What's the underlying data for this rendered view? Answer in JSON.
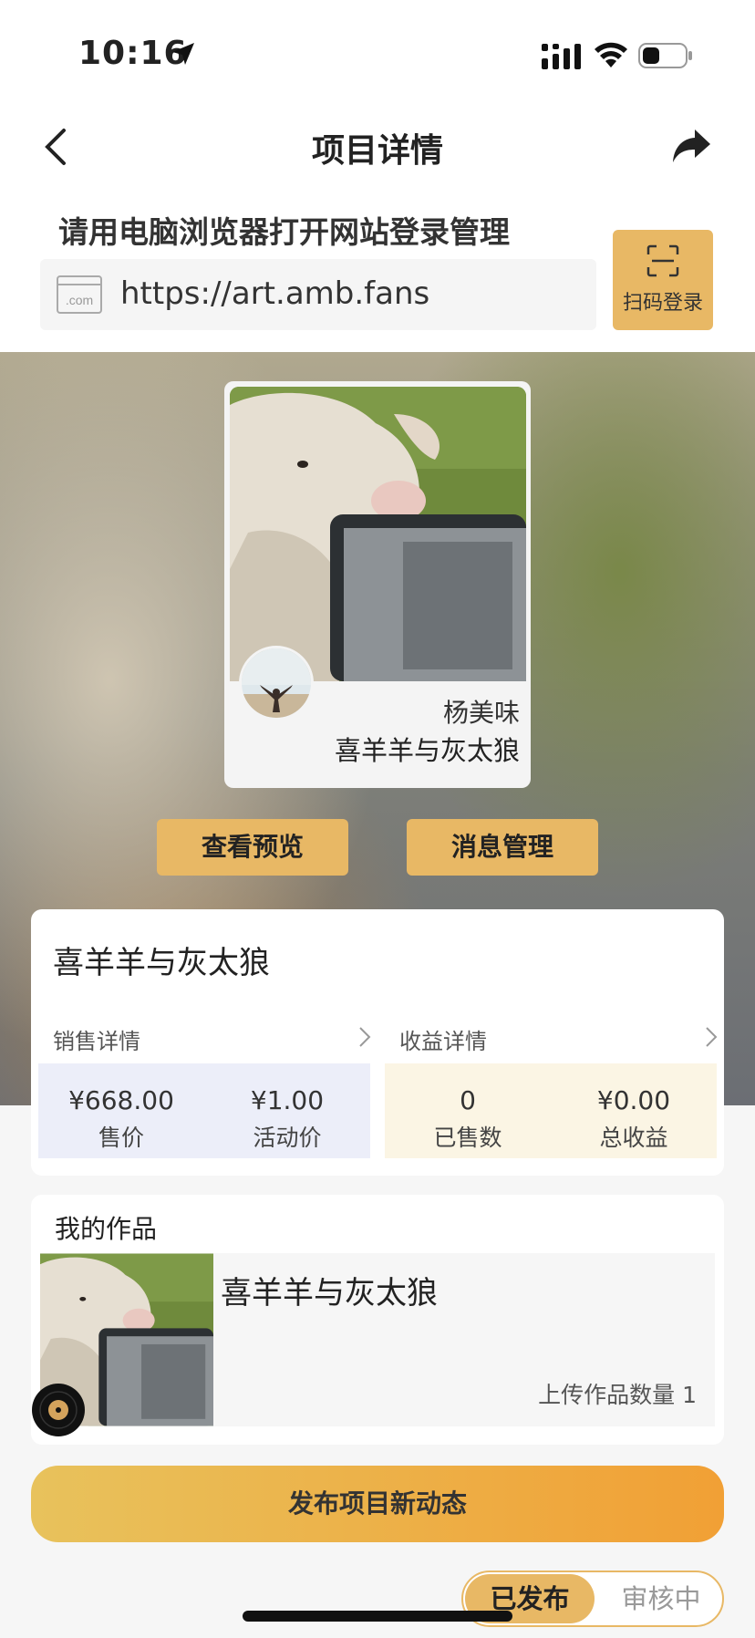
{
  "status_bar": {
    "time": "10:16"
  },
  "nav": {
    "title": "项目详情"
  },
  "login": {
    "hint": "请用电脑浏览器打开网站登录管理",
    "url": "https://art.amb.fans",
    "scan_label": "扫码登录",
    "com_icon_text": ".com"
  },
  "hero": {
    "author": "杨美味",
    "title": "喜羊羊与灰太狼",
    "preview_button": "查看预览",
    "message_button": "消息管理"
  },
  "info": {
    "title": "喜羊羊与灰太狼",
    "sales": {
      "label": "销售详情",
      "items": [
        {
          "value": "¥668.00",
          "caption": "售价"
        },
        {
          "value": "¥1.00",
          "caption": "活动价"
        }
      ]
    },
    "income": {
      "label": "收益详情",
      "items": [
        {
          "value": "0",
          "caption": "已售数"
        },
        {
          "value": "¥0.00",
          "caption": "总收益"
        }
      ]
    }
  },
  "works": {
    "title": "我的作品",
    "item": {
      "title": "喜羊羊与灰太狼",
      "count_text": "上传作品数量  1"
    }
  },
  "publish_button": "发布项目新动态",
  "segment": {
    "published": "已发布",
    "review": "审核中"
  },
  "colors": {
    "accent": "#e8b865",
    "gradient_start": "#e8c25c",
    "gradient_end": "#f1a035"
  }
}
